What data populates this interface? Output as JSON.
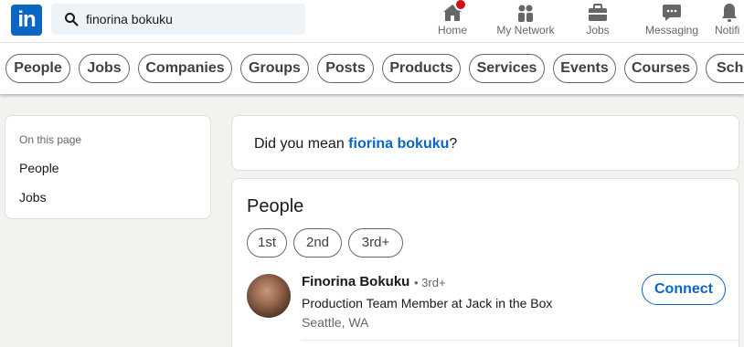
{
  "header": {
    "logo_text": "in",
    "search": {
      "value": "finorina bokuku"
    },
    "nav": [
      {
        "label": "Home",
        "icon": "home-icon"
      },
      {
        "label": "My Network",
        "icon": "network-icon"
      },
      {
        "label": "Jobs",
        "icon": "briefcase-icon"
      },
      {
        "label": "Messaging",
        "icon": "messaging-icon"
      },
      {
        "label": "Notifi",
        "icon": "bell-icon"
      }
    ]
  },
  "filters": [
    "People",
    "Jobs",
    "Companies",
    "Groups",
    "Posts",
    "Products",
    "Services",
    "Events",
    "Courses",
    "Scho"
  ],
  "sidebar": {
    "caption": "On this page",
    "links": [
      "People",
      "Jobs"
    ]
  },
  "suggestion": {
    "prefix": "Did you mean ",
    "term": "fiorina bokuku",
    "suffix": "?"
  },
  "people": {
    "title": "People",
    "connection_filters": [
      "1st",
      "2nd",
      "3rd+"
    ],
    "results": [
      {
        "name": "Finorina Bokuku",
        "degree": "• 3rd+",
        "headline": "Production Team Member at Jack in the Box",
        "location": "Seattle, WA",
        "action": "Connect"
      }
    ]
  },
  "colors": {
    "brand": "#0a66c2",
    "badge": "#cc1016",
    "page_bg": "#f3f2ef"
  }
}
